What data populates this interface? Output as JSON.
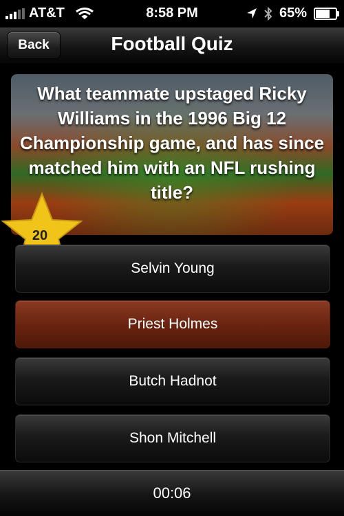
{
  "status_bar": {
    "carrier": "AT&T",
    "time": "8:58 PM",
    "battery": "65%",
    "battery_level": 0.65
  },
  "nav": {
    "back_label": "Back",
    "title": "Football Quiz"
  },
  "question": {
    "text": "What teammate upstaged Ricky Williams in the 1996 Big 12 Championship game, and has since matched him with an NFL rushing title?"
  },
  "points": "20",
  "answers": [
    {
      "label": "Selvin Young",
      "selected": false
    },
    {
      "label": "Priest Holmes",
      "selected": true
    },
    {
      "label": "Butch Hadnot",
      "selected": false
    },
    {
      "label": "Shon Mitchell",
      "selected": false
    }
  ],
  "timer": "00:06",
  "colors": {
    "selected_answer": "#6a2410",
    "star": "#f0c419"
  },
  "icons": [
    "signal-icon",
    "wifi-icon",
    "location-arrow-icon",
    "bluetooth-icon",
    "battery-icon",
    "star-badge-icon"
  ]
}
